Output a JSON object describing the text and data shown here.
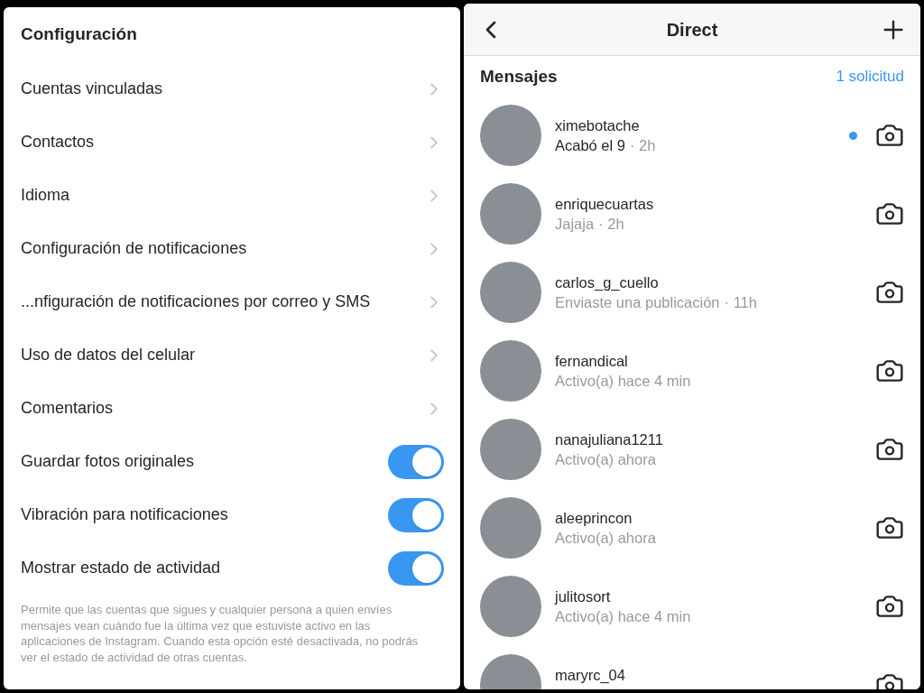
{
  "settings": {
    "title": "Configuración",
    "rows": [
      {
        "kind": "link",
        "label": "Cuentas vinculadas"
      },
      {
        "kind": "link",
        "label": "Contactos"
      },
      {
        "kind": "link",
        "label": "Idioma"
      },
      {
        "kind": "link",
        "label": "Configuración de notificaciones"
      },
      {
        "kind": "link",
        "label": "...nfiguración de notificaciones por correo y SMS"
      },
      {
        "kind": "link",
        "label": "Uso de datos del celular"
      },
      {
        "kind": "link",
        "label": "Comentarios"
      },
      {
        "kind": "toggle",
        "label": "Guardar fotos originales",
        "on": true
      },
      {
        "kind": "toggle",
        "label": "Vibración para notificaciones",
        "on": true
      },
      {
        "kind": "toggle",
        "label": "Mostrar estado de actividad",
        "on": true
      }
    ],
    "footnote": "Permite que las cuentas que sigues y cualquier persona a quien envíes mensajes vean cuándo fue la última vez que estuviste activo en las aplicaciones de Instagram. Cuando esta opción esté desactivada, no podrás ver el estado de actividad de otras cuentas."
  },
  "direct": {
    "title": "Direct",
    "section": "Mensajes",
    "requests": "1 solicitud",
    "conversations": [
      {
        "name": "ximebotache",
        "preview": "Acabó el 9",
        "time": "· 2h",
        "unread": true
      },
      {
        "name": "enriquecuartas",
        "preview": "Jajaja",
        "time": "· 2h",
        "unread": false
      },
      {
        "name": "carlos_g_cuello",
        "preview": "Enviaste una publicación",
        "time": "· 11h",
        "unread": false
      },
      {
        "name": "fernandical",
        "preview": "Activo(a) hace 4 min",
        "unread": false
      },
      {
        "name": "nanajuliana1211",
        "preview": "Activo(a) ahora",
        "unread": false
      },
      {
        "name": "aleeprincon",
        "preview": "Activo(a) ahora",
        "unread": false
      },
      {
        "name": "julitosort",
        "preview": "Activo(a) hace 4 min",
        "unread": false
      },
      {
        "name": "maryrc_04",
        "unread": false
      }
    ]
  }
}
